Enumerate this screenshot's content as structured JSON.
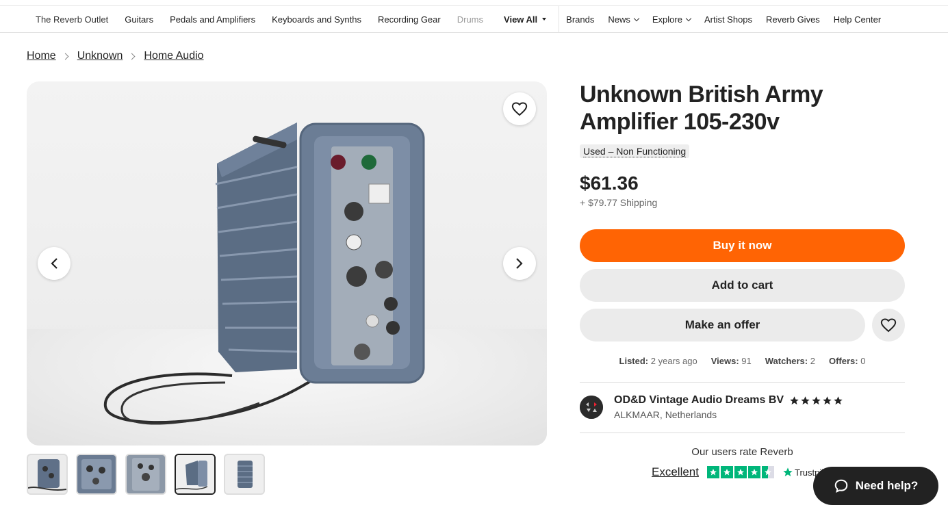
{
  "nav": {
    "items": [
      "The Reverb Outlet",
      "Guitars",
      "Pedals and Amplifiers",
      "Keyboards and Synths",
      "Recording Gear",
      "Drums"
    ],
    "view_all": "View All",
    "right_items": [
      "Brands",
      "News",
      "Explore",
      "Artist Shops",
      "Reverb Gives",
      "Help Center"
    ]
  },
  "breadcrumb": [
    "Home",
    "Unknown",
    "Home Audio"
  ],
  "product": {
    "title": "Unknown British Army Amplifier 105-230v",
    "condition": "Used – Non Functioning",
    "price": "$61.36",
    "shipping": "+ $79.77 Shipping"
  },
  "actions": {
    "buy": "Buy it now",
    "cart": "Add to cart",
    "offer": "Make an offer"
  },
  "stats": {
    "listed_label": "Listed:",
    "listed": "2 years ago",
    "views_label": "Views:",
    "views": "91",
    "watchers_label": "Watchers:",
    "watchers": "2",
    "offers_label": "Offers:",
    "offers": "0"
  },
  "seller": {
    "name": "OD&D Vintage Audio Dreams BV",
    "location": "ALKMAAR, Netherlands",
    "rating": 5
  },
  "trust": {
    "title": "Our users rate Reverb",
    "excellent": "Excellent",
    "brand": "Trustpilot"
  },
  "help": {
    "label": "Need help?"
  },
  "gallery": {
    "thumb_count": 5,
    "active_thumb": 3
  },
  "colors": {
    "accent": "#ff6404",
    "trustpilot": "#00b67a",
    "dark": "#222222"
  },
  "icons": [
    "heart-icon",
    "chevron-left-icon",
    "chevron-right-icon",
    "star-icon",
    "chat-bubble-icon"
  ]
}
